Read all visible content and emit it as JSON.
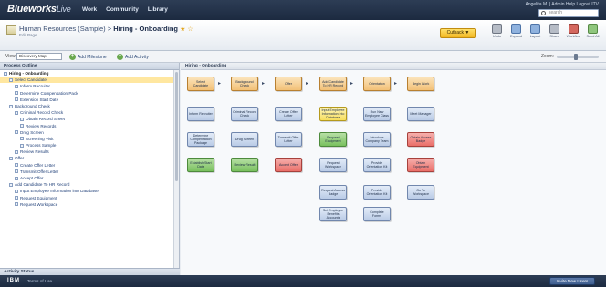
{
  "app": {
    "logo_main": "Blueworks",
    "logo_sub": "Live",
    "nav": [
      "Work",
      "Community",
      "Library"
    ],
    "user_line": "Angelita M. | Admin  Help  Logout  ITV",
    "search_placeholder": "search"
  },
  "header": {
    "breadcrumb_root": "Human Resources (Sample)",
    "breadcrumb_sep": " > ",
    "breadcrumb_current": "Hiring - Onboarding",
    "star": "★ ☆",
    "subtitle": "Edit Page",
    "cutback_label": "Cutback ▼",
    "tools": [
      {
        "label": "Undo",
        "icon": "undo-icon",
        "color": "grey"
      },
      {
        "label": "Expand",
        "icon": "expand-icon",
        "color": "blue"
      },
      {
        "label": "Layout",
        "icon": "layout-icon",
        "color": "blue"
      },
      {
        "label": "Share",
        "icon": "share-icon",
        "color": "grey"
      },
      {
        "label": "Workflow",
        "icon": "workflow-icon",
        "color": "red"
      },
      {
        "label": "Send All",
        "icon": "send-icon",
        "color": "green"
      }
    ]
  },
  "viewbar": {
    "view_label": "View:",
    "view_value": "Discovery Map",
    "add_milestone": "Add Milestone",
    "add_activity": "Add Activity",
    "zoom_label": "Zoom:",
    "zoom_level": 0.45
  },
  "sidebar": {
    "title": "Process Outline",
    "footer": "Activity Status",
    "items": [
      {
        "label": "Hiring - Onboarding",
        "type": "head"
      },
      {
        "label": "Select Candidate",
        "type": "sel"
      },
      {
        "label": "Inform Recruiter",
        "type": "item"
      },
      {
        "label": "Determine Compensation Pack",
        "type": "item"
      },
      {
        "label": "Extension Start Date",
        "type": "item"
      },
      {
        "label": "Background Check",
        "type": "item"
      },
      {
        "label": "Criminal Record Check",
        "type": "item"
      },
      {
        "label": "Obtain Record Sheet",
        "type": "item"
      },
      {
        "label": "Review Records",
        "type": "item"
      },
      {
        "label": "Drug Screen",
        "type": "item"
      },
      {
        "label": "Screening Visit",
        "type": "item"
      },
      {
        "label": "Process Sample",
        "type": "item"
      },
      {
        "label": "Review Results",
        "type": "item"
      },
      {
        "label": "Offer",
        "type": "item"
      },
      {
        "label": "Create Offer Letter",
        "type": "item"
      },
      {
        "label": "Transmit Offer Letter",
        "type": "item"
      },
      {
        "label": "Accept Offer",
        "type": "item"
      },
      {
        "label": "Add Candidate To HR Record",
        "type": "item"
      },
      {
        "label": "Input Employee Information into Database",
        "type": "item"
      },
      {
        "label": "Request Equipment",
        "type": "item"
      },
      {
        "label": "Request Workspace",
        "type": "item"
      }
    ]
  },
  "canvas": {
    "title": "Hiring - Onboarding",
    "milestones": [
      "Select Candidate",
      "Background Check",
      "Offer",
      "Add Candidate To HR Record",
      "Orientation",
      "Begin Work"
    ],
    "activities": [
      {
        "col": 0,
        "row": 1,
        "label": "Inform Recruiter",
        "color": "blue"
      },
      {
        "col": 0,
        "row": 2,
        "label": "Determine Compensation Package",
        "color": "blue"
      },
      {
        "col": 0,
        "row": 3,
        "label": "Establish Start Date",
        "color": "green"
      },
      {
        "col": 1,
        "row": 1,
        "label": "Criminal Record Check",
        "color": "blue"
      },
      {
        "col": 1,
        "row": 2,
        "label": "Drug Screen",
        "color": "blue"
      },
      {
        "col": 1,
        "row": 3,
        "label": "Review Result",
        "color": "green"
      },
      {
        "col": 2,
        "row": 1,
        "label": "Create Offer Letter",
        "color": "blue"
      },
      {
        "col": 2,
        "row": 2,
        "label": "Transmit Offer Letter",
        "color": "blue"
      },
      {
        "col": 2,
        "row": 3,
        "label": "Accept Offer",
        "color": "red"
      },
      {
        "col": 3,
        "row": 1,
        "label": "Input Employee Information into Database",
        "color": "yellow"
      },
      {
        "col": 3,
        "row": 2,
        "label": "Request Equipment",
        "color": "green"
      },
      {
        "col": 3,
        "row": 3,
        "label": "Request Workspace",
        "color": "blue"
      },
      {
        "col": 3,
        "row": 4,
        "label": "Request Access Badge",
        "color": "blue"
      },
      {
        "col": 3,
        "row": 5,
        "label": "Set Employee Benefits Accounts",
        "color": "blue"
      },
      {
        "col": 4,
        "row": 1,
        "label": "Run New Employee Class",
        "color": "blue"
      },
      {
        "col": 4,
        "row": 2,
        "label": "Introduce Company Team",
        "color": "blue"
      },
      {
        "col": 4,
        "row": 3,
        "label": "Provide Orientation Kit",
        "color": "blue"
      },
      {
        "col": 4,
        "row": 4,
        "label": "Provide Orientation Kit",
        "color": "blue"
      },
      {
        "col": 4,
        "row": 5,
        "label": "Complete Forms",
        "color": "blue"
      },
      {
        "col": 5,
        "row": 1,
        "label": "Meet Manager",
        "color": "blue"
      },
      {
        "col": 5,
        "row": 2,
        "label": "Obtain Access Badge",
        "color": "red"
      },
      {
        "col": 5,
        "row": 3,
        "label": "Obtain Equipment",
        "color": "red"
      },
      {
        "col": 5,
        "row": 4,
        "label": "Go To Workspace",
        "color": "blue"
      }
    ]
  },
  "footer": {
    "ibm": "IBM",
    "link": "Terms of Use",
    "button": "Invite New Users"
  }
}
